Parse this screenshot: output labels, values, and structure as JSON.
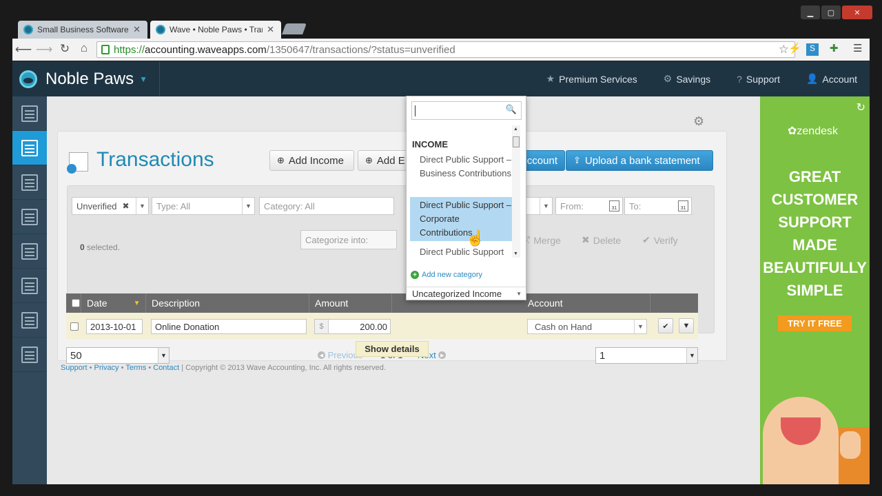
{
  "browser": {
    "tabs": [
      {
        "title": "Small Business Software | ",
        "active": false
      },
      {
        "title": "Wave • Noble Paws • Tran",
        "active": true
      }
    ],
    "url": {
      "scheme": "https://",
      "host": "accounting.waveapps.com",
      "path": "/1350647/transactions/?status=unverified"
    }
  },
  "app": {
    "business_name": "Noble Paws",
    "topnav": [
      {
        "label": "Premium Services",
        "icon": "star-icon"
      },
      {
        "label": "Savings",
        "icon": "gear-icon"
      },
      {
        "label": "Support",
        "icon": "help-icon"
      },
      {
        "label": "Account",
        "icon": "user-icon"
      }
    ],
    "sidebar": [
      {
        "name": "dashboard",
        "active": false
      },
      {
        "name": "transactions",
        "active": true
      },
      {
        "name": "invoices",
        "active": false
      },
      {
        "name": "bills",
        "active": false
      },
      {
        "name": "receipts",
        "active": false
      },
      {
        "name": "accounting",
        "active": false
      },
      {
        "name": "reports",
        "active": false
      },
      {
        "name": "contacts",
        "active": false
      }
    ]
  },
  "page": {
    "title": "Transactions",
    "buttons": {
      "add_income": "Add Income",
      "add_expense": "Add E",
      "account": "ccount",
      "upload": "Upload a bank statement"
    },
    "filters": {
      "status": "Unverified",
      "type_placeholder": "Type: All",
      "category_placeholder": "Category: All",
      "from_placeholder": "From:",
      "to_placeholder": "To:"
    },
    "selected_count": "0",
    "selected_label": " selected.",
    "categorize_placeholder": "Categorize into:",
    "bulk": {
      "merge": "Merge",
      "delete": "Delete",
      "verify": "Verify"
    },
    "table": {
      "headers": {
        "date": "Date",
        "description": "Description",
        "amount": "Amount",
        "account": "Account"
      },
      "rows": [
        {
          "date": "2013-10-01",
          "description": "Online Donation",
          "currency": "$",
          "amount": "200.00",
          "account": "Cash on Hand"
        }
      ]
    },
    "per_page": "50",
    "pagination": {
      "previous": "Previous",
      "page_info": "1 of 1",
      "next": "Next",
      "page": "1"
    },
    "tooltip": "Show details"
  },
  "dropdown": {
    "search_value": "",
    "group": "INCOME",
    "options": [
      {
        "label": "Direct Public Support – Business Contributions",
        "highlighted": false
      },
      {
        "label": "Direct Public Support – Corporate Contributions",
        "highlighted": true
      },
      {
        "label": "Direct Public Support",
        "highlighted": false
      }
    ],
    "add_new": "Add new category",
    "current": "Uncategorized Income"
  },
  "footer": {
    "links": [
      "Support",
      "Privacy",
      "Terms",
      "Contact"
    ],
    "copyright": "| Copyright © 2013 Wave Accounting, Inc. All rights reserved."
  },
  "ad": {
    "brand": "zendesk",
    "headline": "GREAT\nCUSTOMER\nSUPPORT\nMADE\nBEAUTIFULLY\nSIMPLE",
    "cta": "TRY IT FREE"
  }
}
